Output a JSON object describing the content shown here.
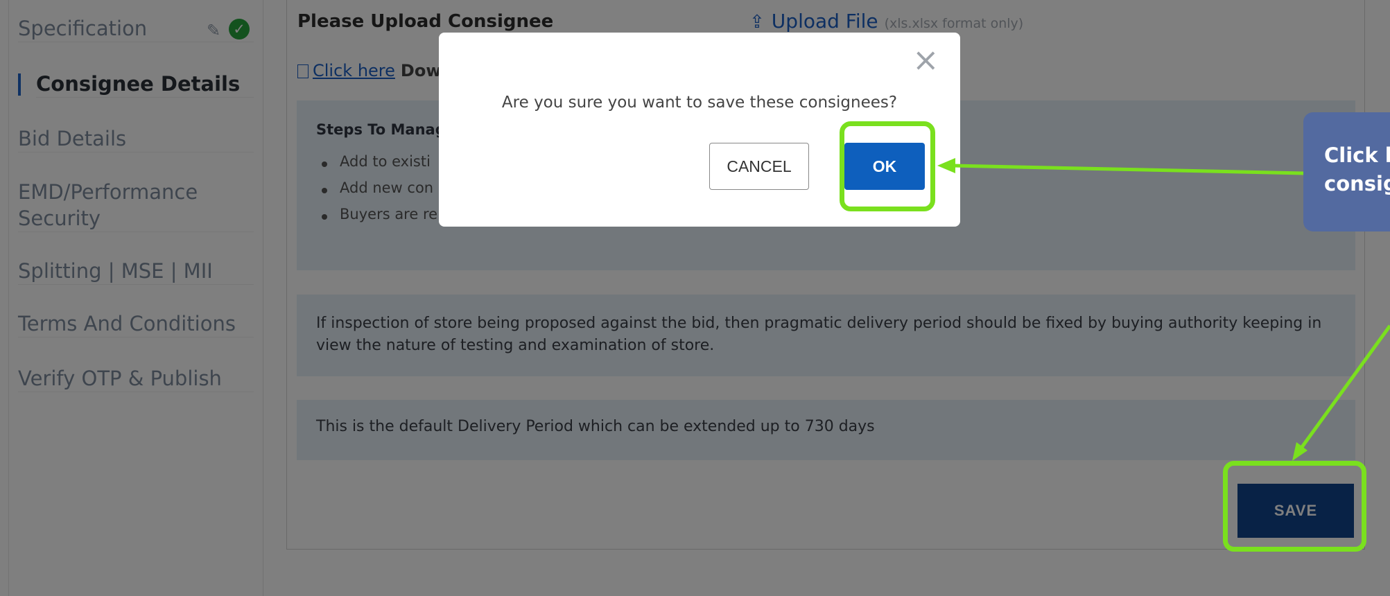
{
  "sidebar": {
    "items": [
      {
        "label": "Specification"
      },
      {
        "label": "Consignee Details"
      },
      {
        "label": "Bid Details"
      },
      {
        "label": "EMD/Performance"
      },
      {
        "label": "Security"
      },
      {
        "label": "Splitting | MSE | MII"
      },
      {
        "label": "Terms And Conditions"
      },
      {
        "label": "Verify OTP & Publish"
      }
    ]
  },
  "upload": {
    "label": "Please Upload Consignee",
    "button": "Upload File",
    "hint": "(xls.xlsx format only)"
  },
  "download": {
    "link": "Click here",
    "rest": "Dow"
  },
  "steps": {
    "title": "Steps To Manag",
    "items": [
      "Add to existi",
      "Add new con",
      "Buyers are re"
    ]
  },
  "info": {
    "inspection": "If inspection of store being proposed against the bid, then pragmatic delivery period should be fixed by buying authority keeping in view the nature of testing and examination of store.",
    "default_period": "This is the default Delivery Period which can be extended up to 730 days"
  },
  "save_label": "SAVE",
  "modal": {
    "close": "×",
    "message": "Are you sure you want to save these consignees?",
    "cancel": "CANCEL",
    "ok": "OK"
  },
  "callout": {
    "line1": "Click h",
    "line2": "consig"
  },
  "colors": {
    "accent": "#10458c",
    "ok_blue": "#0e5fbd",
    "highlight": "#7ae01e",
    "callout": "#536aa0"
  }
}
